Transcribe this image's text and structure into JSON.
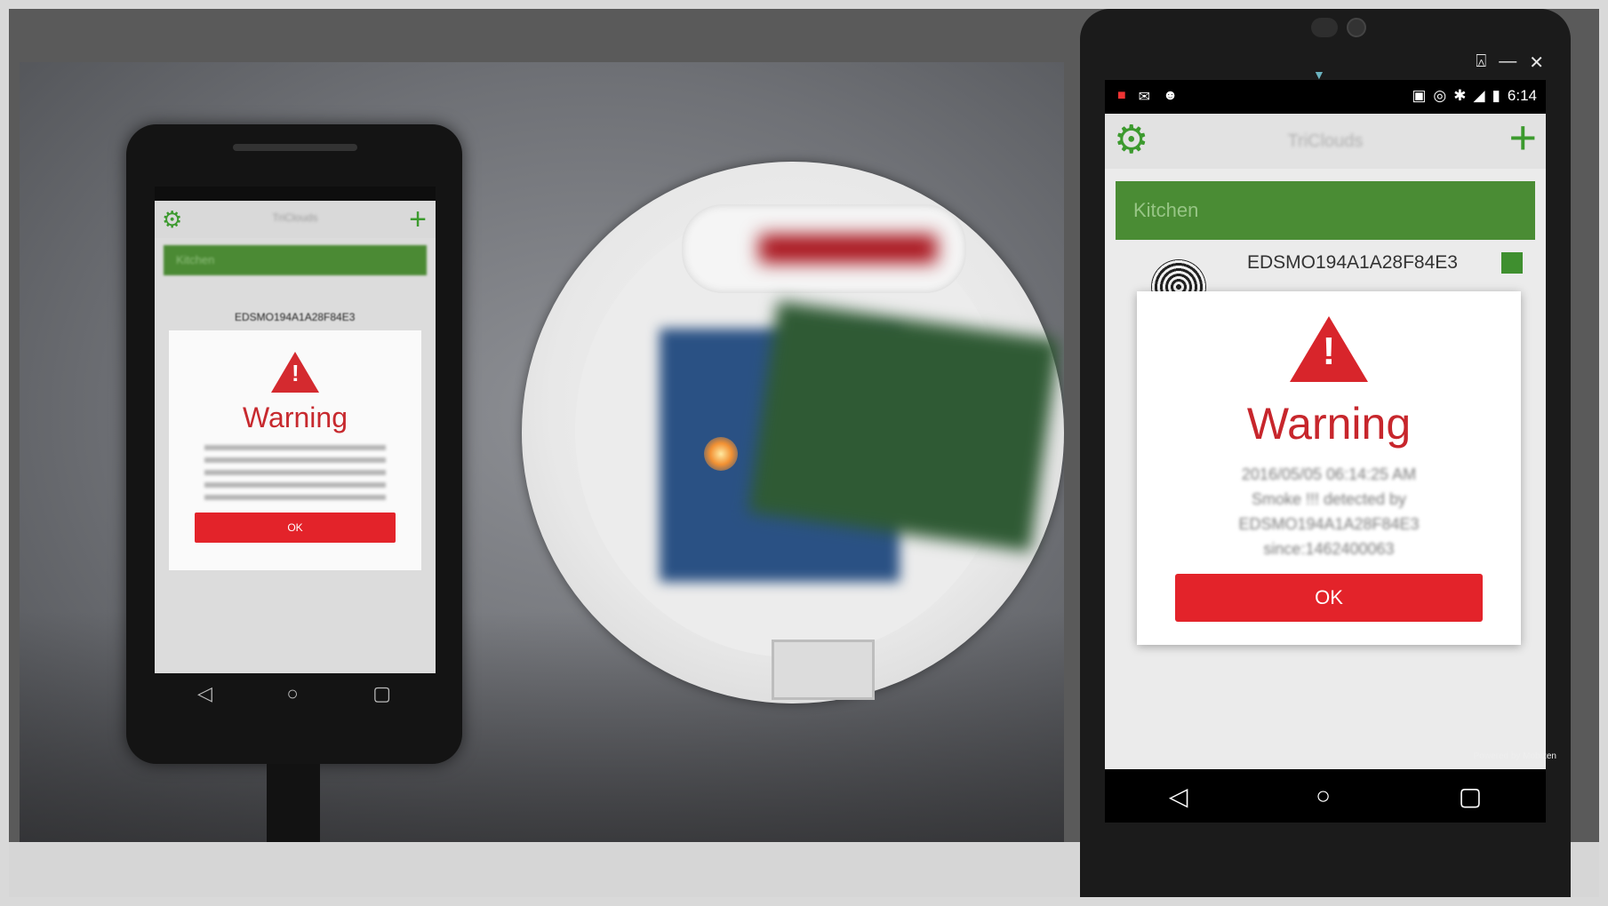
{
  "left_phone": {
    "app_title": "TriClouds",
    "room_label": "Kitchen",
    "device_name": "EDSMO194A1A28F84E3",
    "dialog": {
      "title": "Warning",
      "ok_label": "OK"
    },
    "nav_icons": [
      "back-icon",
      "home-icon",
      "recents-icon"
    ]
  },
  "right_device": {
    "window_controls": [
      "notification-icon",
      "minimize-icon",
      "close-icon"
    ],
    "status_bar": {
      "time": "6:14",
      "left_icons": [
        "app-notification-icon",
        "gmail-icon",
        "android-icon"
      ],
      "right_icons": [
        "cast-icon",
        "hotspot-icon",
        "bluetooth-icon",
        "signal-icon",
        "battery-icon"
      ]
    },
    "app_bar": {
      "title": "TriClouds",
      "settings_icon": "gear-icon",
      "add_icon": "plus-icon"
    },
    "room_label": "Kitchen",
    "device_name": "EDSMO194A1A28F84E3",
    "dialog": {
      "title": "Warning",
      "message_lines": [
        "2016/05/05 06:14:25 AM",
        "Smoke !!! detected by",
        "EDSMO194A1A28F84E3",
        "since:1462400063"
      ],
      "ok_label": "OK"
    },
    "nav_icons": [
      "back-icon",
      "home-icon",
      "recents-icon"
    ],
    "watermark": "Powered by Mobizen"
  },
  "colors": {
    "accent_green": "#3c9a2e",
    "warning_red": "#e3232a"
  }
}
